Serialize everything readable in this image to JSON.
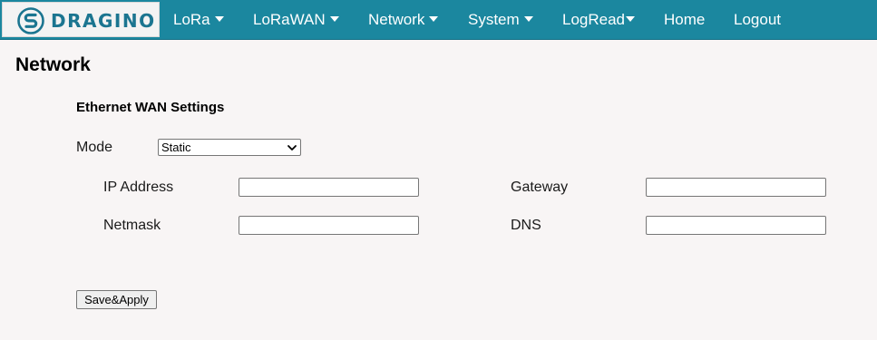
{
  "brand": {
    "logo_text": "DRAGINO",
    "logo_icon": "dragino-s-logo-icon",
    "colors": {
      "navbar": "#1b879f",
      "logo_text": "#1b7590",
      "page_bg": "#f8f5f5"
    }
  },
  "nav": {
    "lora": "LoRa",
    "lorawan": "LoRaWAN",
    "network": "Network",
    "system": "System",
    "logread": "LogRead",
    "home": "Home",
    "logout": "Logout"
  },
  "page": {
    "title": "Network"
  },
  "ethernet": {
    "section_title": "Ethernet WAN Settings",
    "mode_label": "Mode",
    "mode_value": "Static",
    "ip_label": "IP Address",
    "ip_value": "",
    "gateway_label": "Gateway",
    "gateway_value": "",
    "netmask_label": "Netmask",
    "netmask_value": "",
    "dns_label": "DNS",
    "dns_value": "",
    "save_label": "Save&Apply"
  }
}
